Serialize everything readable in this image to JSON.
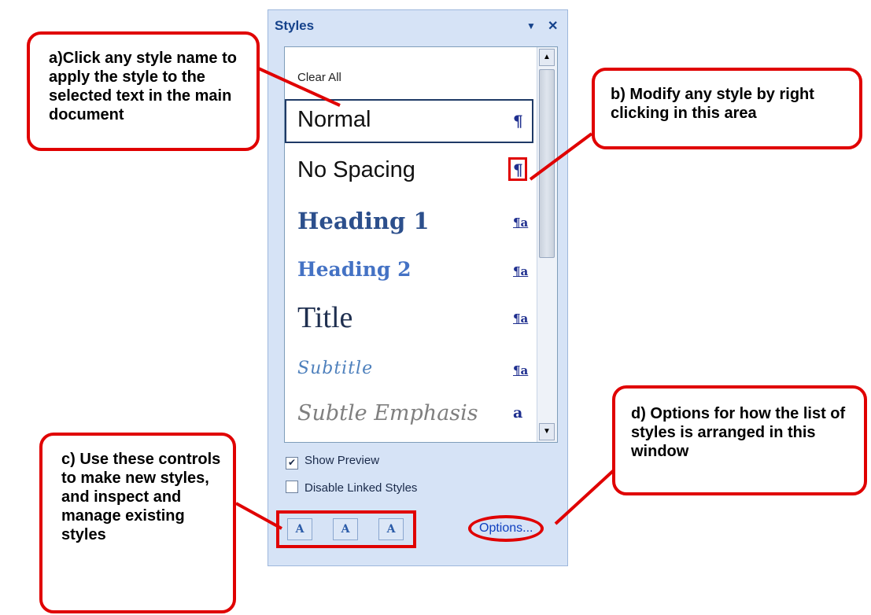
{
  "pane": {
    "title": "Styles",
    "menu_glyph": "▼",
    "close_glyph": "✕",
    "clear_all": "Clear All",
    "styles": [
      {
        "name": "Normal",
        "mark": "¶"
      },
      {
        "name": "No Spacing",
        "mark": "¶"
      },
      {
        "name": "Heading 1",
        "mark": "¶a"
      },
      {
        "name": "Heading 2",
        "mark": "¶a"
      },
      {
        "name": "Title",
        "mark": "¶a"
      },
      {
        "name": "Subtitle",
        "mark": "¶a"
      },
      {
        "name": "Subtle Emphasis",
        "mark": "a"
      }
    ],
    "show_preview": {
      "label": "Show Preview",
      "checked": true,
      "glyph": "✔"
    },
    "disable_linked": {
      "label": "Disable Linked Styles",
      "checked": false
    },
    "controls": {
      "new_style": "A",
      "style_inspector": "A",
      "manage_styles": "A"
    },
    "options_label": "Options..."
  },
  "callouts": {
    "a": "a)Click any style name to apply the style to the selected text in the main document",
    "b": "b) Modify any style by right clicking in this area",
    "c": "c) Use these controls to make new styles, and inspect and manage existing styles",
    "d": "d) Options for how the list of styles is arranged in this window"
  },
  "colors": {
    "annotation": "#e00000",
    "pane_bg": "#d6e3f6",
    "title_text": "#15428b"
  }
}
